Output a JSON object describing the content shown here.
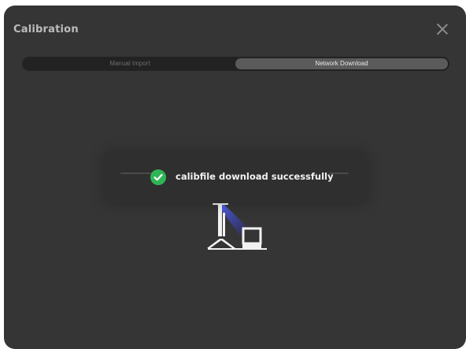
{
  "dialog": {
    "title": "Calibration",
    "close_icon": "close-icon"
  },
  "tabs": [
    {
      "label": "Manual Import",
      "active": false
    },
    {
      "label": "Network Download",
      "active": true
    }
  ],
  "toast": {
    "icon": "check-circle-icon",
    "message": "calibfile download successfully",
    "icon_color": "#2fb557"
  },
  "illustration": {
    "icon": "calibration-device-icon",
    "beam_color": "#3d4de0"
  },
  "colors": {
    "dialog_bg": "#353535",
    "active_tab_bg": "#5b5b5b"
  }
}
